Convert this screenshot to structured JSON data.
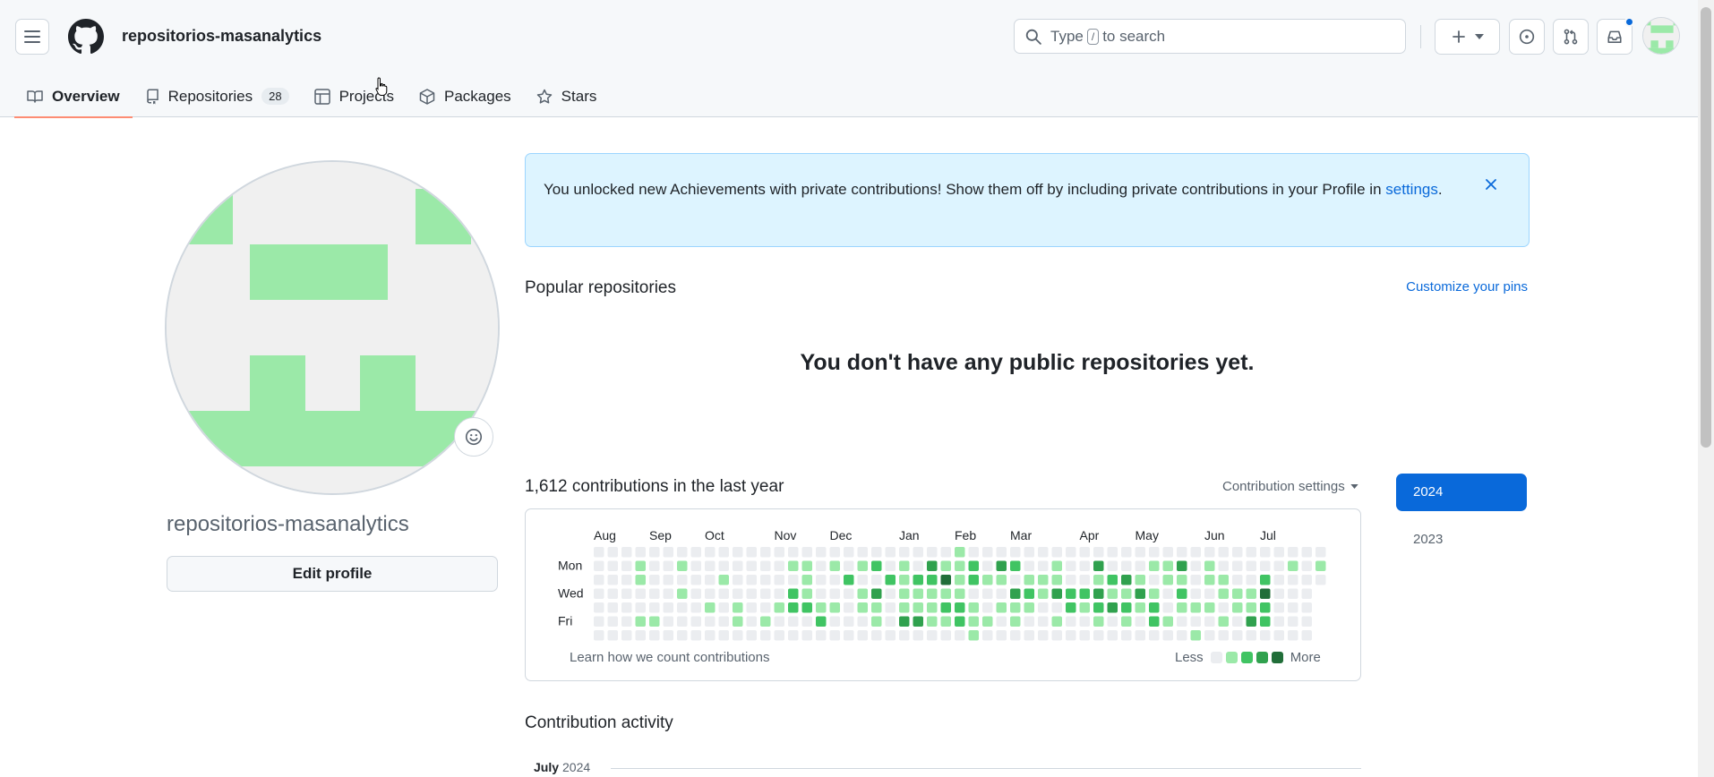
{
  "header": {
    "owner": "repositorios-masanalytics",
    "search_prefix": "Type",
    "search_key": "/",
    "search_suffix": "to search"
  },
  "tabs": [
    {
      "label": "Overview",
      "icon": "book-icon",
      "active": true
    },
    {
      "label": "Repositories",
      "icon": "repo-icon",
      "count": "28"
    },
    {
      "label": "Projects",
      "icon": "table-icon"
    },
    {
      "label": "Packages",
      "icon": "package-icon"
    },
    {
      "label": "Stars",
      "icon": "star-icon"
    }
  ],
  "profile": {
    "username": "repositorios-masanalytics",
    "edit_label": "Edit profile"
  },
  "flash": {
    "message": "You unlocked new Achievements with private contributions! Show them off by including private contributions in your Profile in",
    "link": "settings",
    "end": "."
  },
  "popular": {
    "title": "Popular repositories",
    "customize": "Customize your pins",
    "empty": "You don't have any public repositories yet."
  },
  "contributions": {
    "title": "1,612 contributions in the last year",
    "settings_label": "Contribution settings",
    "months": [
      "Aug",
      "Sep",
      "Oct",
      "Nov",
      "Dec",
      "Jan",
      "Feb",
      "Mar",
      "Apr",
      "May",
      "Jun",
      "Jul"
    ],
    "days": [
      "Mon",
      "Wed",
      "Fri"
    ],
    "learn": "Learn how we count contributions",
    "less": "Less",
    "more": "More",
    "colors": [
      "#ebedf0",
      "#9be9a8",
      "#40c463",
      "#30a14e",
      "#216e39"
    ]
  },
  "years": [
    "2024",
    "2023"
  ],
  "activity": {
    "title": "Contribution activity",
    "month": "July",
    "year": "2024"
  }
}
